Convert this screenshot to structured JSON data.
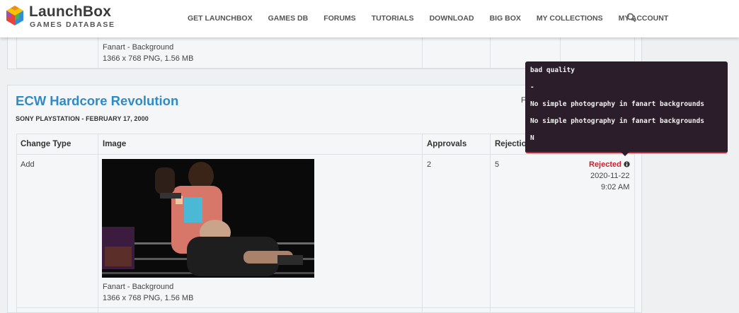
{
  "header": {
    "logo_title": "LaunchBox",
    "logo_subtitle": "GAMES DATABASE",
    "nav": [
      "GET LAUNCHBOX",
      "GAMES DB",
      "FORUMS",
      "TUTORIALS",
      "DOWNLOAD",
      "BIG BOX",
      "MY COLLECTIONS",
      "MY ACCOUNT"
    ],
    "search_icon": "search-icon"
  },
  "prev_entry": {
    "image_type": "Fanart - Background",
    "image_info": "1366 x 768 PNG, 1.56 MB"
  },
  "entry": {
    "title": "ECW Hardcore Revolution",
    "subtitle": "SONY PLAYSTATION - FEBRUARY 17, 2000",
    "partial_label": "F",
    "columns": {
      "change_type": "Change Type",
      "image": "Image",
      "approvals": "Approvals",
      "rejections": "Rejection"
    },
    "row": {
      "change_type": "Add",
      "approvals": "2",
      "rejections": "5",
      "status": "Rejected",
      "date": "2020-11-22",
      "time": "9:02 AM",
      "image_type": "Fanart - Background",
      "image_info": "1366 x 768 PNG, 1.56 MB"
    }
  },
  "tooltip": {
    "lines": [
      "bad quality",
      "-",
      "No simple photography in fanart backgrounds",
      "No simple photography in fanart backgrounds",
      "N"
    ]
  },
  "colors": {
    "accent": "#2e8bc7",
    "rejected": "#c8202d",
    "tooltip_bg": "#2b1d2a"
  }
}
